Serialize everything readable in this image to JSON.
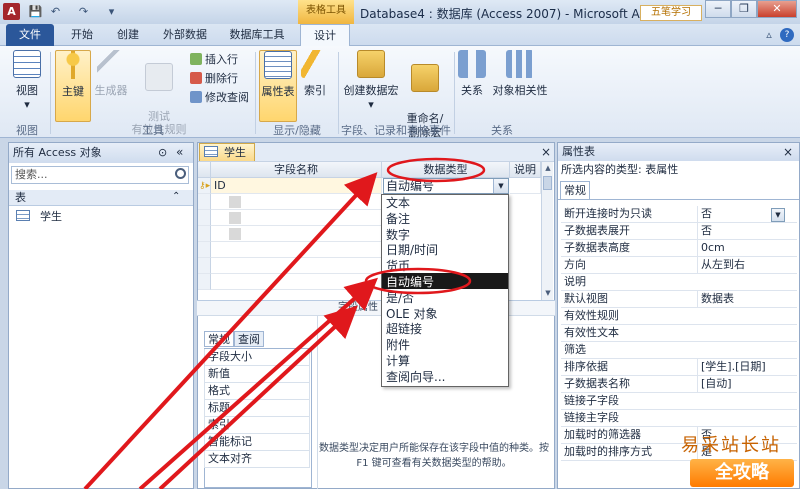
{
  "title_bar": {
    "app_icon_letter": "A",
    "context_tab": "表格工具",
    "window_title": "Database4 : 数据库 (Access 2007)  -  Microsoft Access",
    "watermark_logo": "五笔学习",
    "minimize": "─",
    "restore": "❐",
    "close": "✕",
    "quick_access": [
      "💾",
      "↶",
      "↷",
      "▾"
    ]
  },
  "ribbon_tabs": [
    "文件",
    "开始",
    "创建",
    "外部数据",
    "数据库工具",
    "设计"
  ],
  "ribbon_controls": {
    "collapse": "▵",
    "help": "?"
  },
  "ribbon": {
    "view": {
      "label": "视图",
      "group": "视图"
    },
    "tools": {
      "primary_key": "主键",
      "builder": "生成器",
      "test_rules": "测试\n有效性规则",
      "insert_row": "插入行",
      "delete_row": "删除行",
      "modify_lookup": "修改查阅",
      "group": "工具"
    },
    "show_hide": {
      "property_sheet": "属性表",
      "indexes": "索引",
      "group": "显示/隐藏"
    },
    "events": {
      "create_macro": "创建数据宏",
      "rename_delete_macro": "重命名/\n删除宏",
      "group": "字段、记录和表格事件"
    },
    "relationships": {
      "relationships": "关系",
      "dependencies": "对象相关性",
      "group": "关系"
    }
  },
  "nav_pane": {
    "header": "所有 Access 对象",
    "search_placeholder": "搜索...",
    "group": "表",
    "items": [
      "学生"
    ],
    "collapse_icon": "«",
    "menu_icon": "⊙",
    "group_collapse": "⌃"
  },
  "document": {
    "tab": "学生",
    "close": "×",
    "columns": [
      "字段名称",
      "数据类型",
      "说明"
    ],
    "rows": [
      {
        "name": "ID",
        "type": "自动编号"
      }
    ],
    "field_props_label": "字段属性",
    "field_prop_tabs": [
      "常规",
      "查阅"
    ],
    "field_props": [
      "字段大小",
      "新值",
      "格式",
      "标题",
      "索引",
      "智能标记",
      "文本对齐"
    ],
    "help_text": "数据类型决定用户所能保存在该字段中值的种类。按 F1 键可查看有关数据类型的帮助。"
  },
  "datatype_dropdown": {
    "options": [
      "文本",
      "备注",
      "数字",
      "日期/时间",
      "货币",
      "自动编号",
      "是/否",
      "OLE 对象",
      "超链接",
      "附件",
      "计算",
      "查阅向导..."
    ],
    "selected_index": 5
  },
  "property_sheet": {
    "title": "属性表",
    "close": "×",
    "selection_type": "所选内容的类型: 表属性",
    "tab": "常规",
    "properties": [
      {
        "name": "断开连接时为只读",
        "value": "否"
      },
      {
        "name": "子数据表展开",
        "value": "否"
      },
      {
        "name": "子数据表高度",
        "value": "0cm"
      },
      {
        "name": "方向",
        "value": "从左到右"
      },
      {
        "name": "说明",
        "value": ""
      },
      {
        "name": "默认视图",
        "value": "数据表"
      },
      {
        "name": "有效性规则",
        "value": ""
      },
      {
        "name": "有效性文本",
        "value": ""
      },
      {
        "name": "筛选",
        "value": ""
      },
      {
        "name": "排序依据",
        "value": "[学生].[日期]"
      },
      {
        "name": "子数据表名称",
        "value": "[自动]"
      },
      {
        "name": "链接子字段",
        "value": ""
      },
      {
        "name": "链接主字段",
        "value": ""
      },
      {
        "name": "加载时的筛选器",
        "value": "否"
      },
      {
        "name": "加载时的排序方式",
        "value": "是"
      }
    ]
  },
  "watermark": {
    "line1": "易采站长站",
    "line2": "全攻略"
  },
  "colors": {
    "annotation_red": "#e0181c",
    "file_tab": "#2b579a",
    "context_tab": "#f0b640"
  }
}
